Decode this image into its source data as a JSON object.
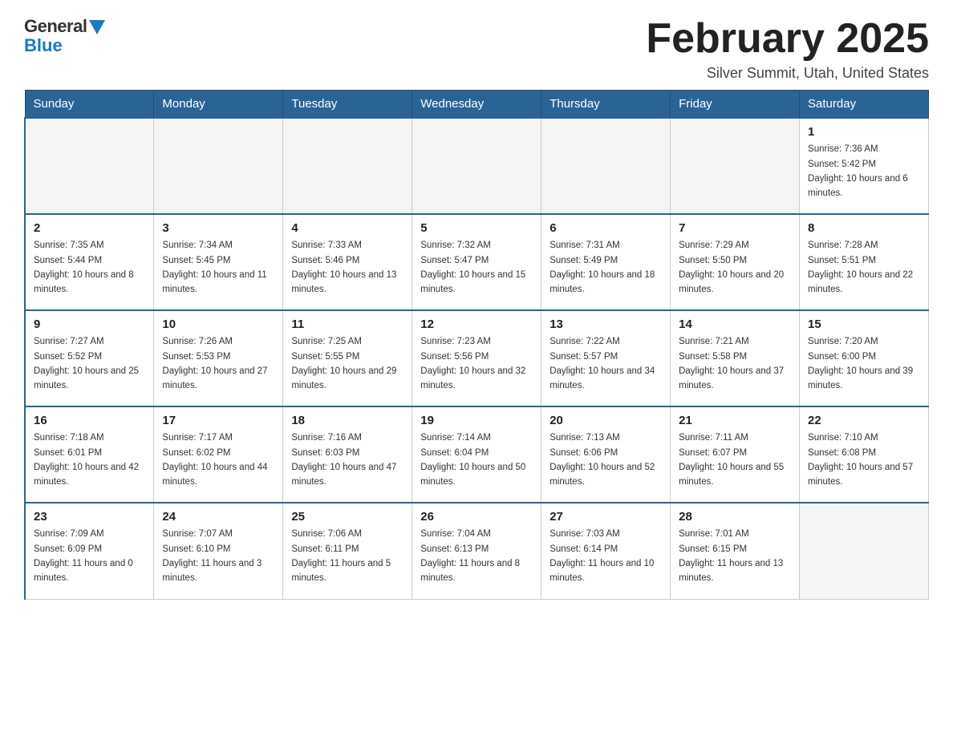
{
  "logo": {
    "general_text": "General",
    "blue_text": "Blue"
  },
  "header": {
    "month_year": "February 2025",
    "location": "Silver Summit, Utah, United States"
  },
  "weekdays": [
    "Sunday",
    "Monday",
    "Tuesday",
    "Wednesday",
    "Thursday",
    "Friday",
    "Saturday"
  ],
  "weeks": [
    [
      {
        "day": "",
        "empty": true
      },
      {
        "day": "",
        "empty": true
      },
      {
        "day": "",
        "empty": true
      },
      {
        "day": "",
        "empty": true
      },
      {
        "day": "",
        "empty": true
      },
      {
        "day": "",
        "empty": true
      },
      {
        "day": "1",
        "sunrise": "7:36 AM",
        "sunset": "5:42 PM",
        "daylight": "10 hours and 6 minutes."
      }
    ],
    [
      {
        "day": "2",
        "sunrise": "7:35 AM",
        "sunset": "5:44 PM",
        "daylight": "10 hours and 8 minutes."
      },
      {
        "day": "3",
        "sunrise": "7:34 AM",
        "sunset": "5:45 PM",
        "daylight": "10 hours and 11 minutes."
      },
      {
        "day": "4",
        "sunrise": "7:33 AM",
        "sunset": "5:46 PM",
        "daylight": "10 hours and 13 minutes."
      },
      {
        "day": "5",
        "sunrise": "7:32 AM",
        "sunset": "5:47 PM",
        "daylight": "10 hours and 15 minutes."
      },
      {
        "day": "6",
        "sunrise": "7:31 AM",
        "sunset": "5:49 PM",
        "daylight": "10 hours and 18 minutes."
      },
      {
        "day": "7",
        "sunrise": "7:29 AM",
        "sunset": "5:50 PM",
        "daylight": "10 hours and 20 minutes."
      },
      {
        "day": "8",
        "sunrise": "7:28 AM",
        "sunset": "5:51 PM",
        "daylight": "10 hours and 22 minutes."
      }
    ],
    [
      {
        "day": "9",
        "sunrise": "7:27 AM",
        "sunset": "5:52 PM",
        "daylight": "10 hours and 25 minutes."
      },
      {
        "day": "10",
        "sunrise": "7:26 AM",
        "sunset": "5:53 PM",
        "daylight": "10 hours and 27 minutes."
      },
      {
        "day": "11",
        "sunrise": "7:25 AM",
        "sunset": "5:55 PM",
        "daylight": "10 hours and 29 minutes."
      },
      {
        "day": "12",
        "sunrise": "7:23 AM",
        "sunset": "5:56 PM",
        "daylight": "10 hours and 32 minutes."
      },
      {
        "day": "13",
        "sunrise": "7:22 AM",
        "sunset": "5:57 PM",
        "daylight": "10 hours and 34 minutes."
      },
      {
        "day": "14",
        "sunrise": "7:21 AM",
        "sunset": "5:58 PM",
        "daylight": "10 hours and 37 minutes."
      },
      {
        "day": "15",
        "sunrise": "7:20 AM",
        "sunset": "6:00 PM",
        "daylight": "10 hours and 39 minutes."
      }
    ],
    [
      {
        "day": "16",
        "sunrise": "7:18 AM",
        "sunset": "6:01 PM",
        "daylight": "10 hours and 42 minutes."
      },
      {
        "day": "17",
        "sunrise": "7:17 AM",
        "sunset": "6:02 PM",
        "daylight": "10 hours and 44 minutes."
      },
      {
        "day": "18",
        "sunrise": "7:16 AM",
        "sunset": "6:03 PM",
        "daylight": "10 hours and 47 minutes."
      },
      {
        "day": "19",
        "sunrise": "7:14 AM",
        "sunset": "6:04 PM",
        "daylight": "10 hours and 50 minutes."
      },
      {
        "day": "20",
        "sunrise": "7:13 AM",
        "sunset": "6:06 PM",
        "daylight": "10 hours and 52 minutes."
      },
      {
        "day": "21",
        "sunrise": "7:11 AM",
        "sunset": "6:07 PM",
        "daylight": "10 hours and 55 minutes."
      },
      {
        "day": "22",
        "sunrise": "7:10 AM",
        "sunset": "6:08 PM",
        "daylight": "10 hours and 57 minutes."
      }
    ],
    [
      {
        "day": "23",
        "sunrise": "7:09 AM",
        "sunset": "6:09 PM",
        "daylight": "11 hours and 0 minutes."
      },
      {
        "day": "24",
        "sunrise": "7:07 AM",
        "sunset": "6:10 PM",
        "daylight": "11 hours and 3 minutes."
      },
      {
        "day": "25",
        "sunrise": "7:06 AM",
        "sunset": "6:11 PM",
        "daylight": "11 hours and 5 minutes."
      },
      {
        "day": "26",
        "sunrise": "7:04 AM",
        "sunset": "6:13 PM",
        "daylight": "11 hours and 8 minutes."
      },
      {
        "day": "27",
        "sunrise": "7:03 AM",
        "sunset": "6:14 PM",
        "daylight": "11 hours and 10 minutes."
      },
      {
        "day": "28",
        "sunrise": "7:01 AM",
        "sunset": "6:15 PM",
        "daylight": "11 hours and 13 minutes."
      },
      {
        "day": "",
        "empty": true
      }
    ]
  ],
  "labels": {
    "sunrise": "Sunrise:",
    "sunset": "Sunset:",
    "daylight": "Daylight:"
  }
}
